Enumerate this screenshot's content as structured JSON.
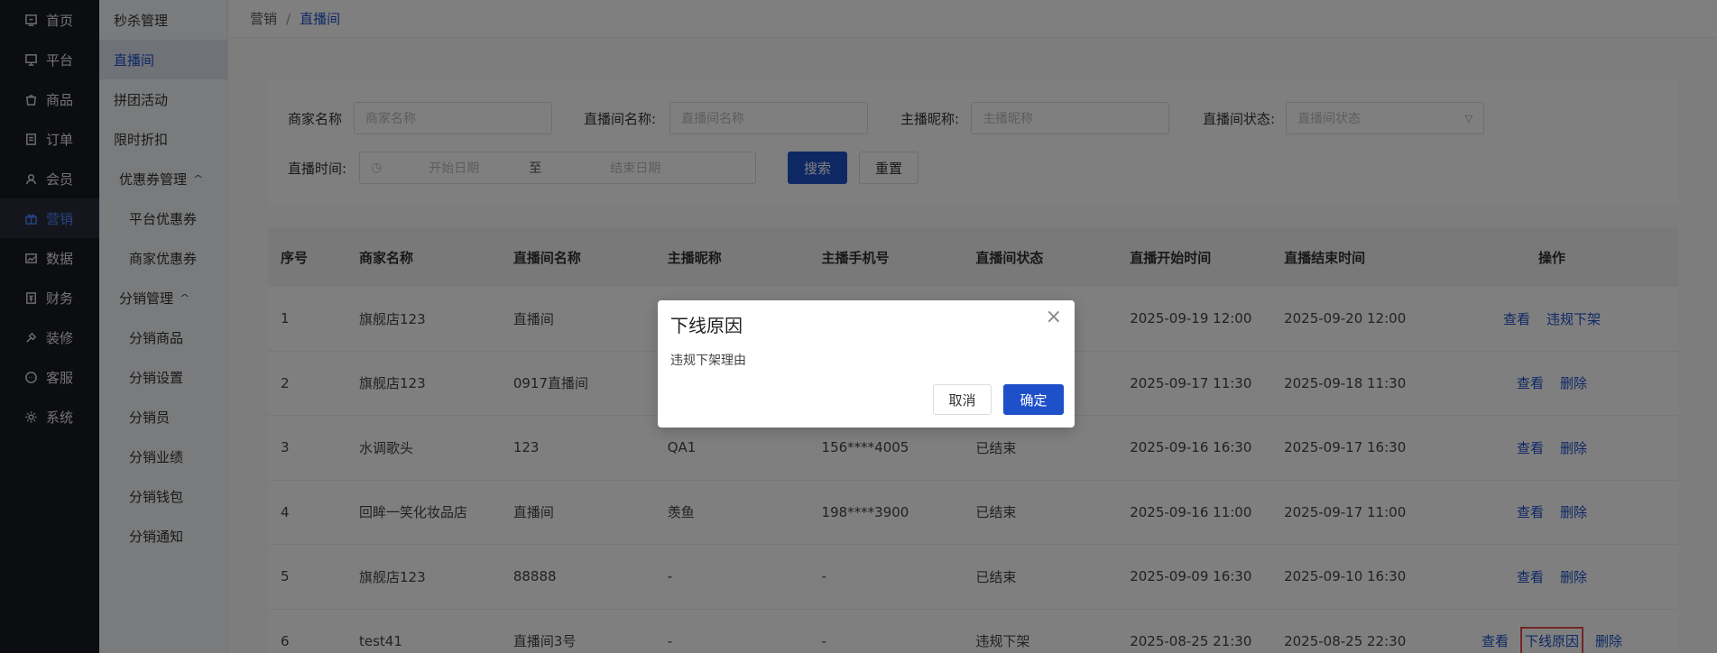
{
  "nav": {
    "items": [
      {
        "label": "首页",
        "icon": "home-icon"
      },
      {
        "label": "平台",
        "icon": "platform-icon"
      },
      {
        "label": "商品",
        "icon": "goods-icon"
      },
      {
        "label": "订单",
        "icon": "order-icon"
      },
      {
        "label": "会员",
        "icon": "member-icon"
      },
      {
        "label": "营销",
        "icon": "gift-icon"
      },
      {
        "label": "数据",
        "icon": "data-icon"
      },
      {
        "label": "财务",
        "icon": "finance-icon"
      },
      {
        "label": "装修",
        "icon": "decorate-icon"
      },
      {
        "label": "客服",
        "icon": "chat-icon"
      },
      {
        "label": "系统",
        "icon": "gear-icon"
      }
    ]
  },
  "subnav": {
    "items": [
      "秒杀管理",
      "直播间",
      "拼团活动",
      "限时折扣",
      "优惠券管理",
      "平台优惠券",
      "商家优惠券",
      "分销管理",
      "分销商品",
      "分销设置",
      "分销员",
      "分销业绩",
      "分销钱包",
      "分销通知"
    ]
  },
  "breadcrumb": {
    "parent": "营销",
    "separator": "/",
    "current": "直播间"
  },
  "filters": {
    "merchant_label": "商家名称",
    "merchant_placeholder": "商家名称",
    "room_label": "直播间名称:",
    "room_placeholder": "直播间名称",
    "anchor_label": "主播昵称:",
    "anchor_placeholder": "主播昵称",
    "status_label": "直播间状态:",
    "status_placeholder": "直播间状态",
    "time_label": "直播时间:",
    "start_placeholder": "开始日期",
    "range_sep": "至",
    "end_placeholder": "结束日期",
    "search_btn": "搜索",
    "reset_btn": "重置"
  },
  "table": {
    "headers": [
      "序号",
      "商家名称",
      "直播间名称",
      "主播昵称",
      "主播手机号",
      "直播间状态",
      "直播开始时间",
      "直播结束时间",
      "操作"
    ],
    "rows": [
      [
        "1",
        "旗舰店123",
        "直播间",
        "",
        "",
        "",
        "2025-09-19 12:00",
        "2025-09-20 12:00"
      ],
      [
        "2",
        "旗舰店123",
        "0917直播间",
        "",
        "",
        "",
        "2025-09-17 11:30",
        "2025-09-18 11:30"
      ],
      [
        "3",
        "水调歌头",
        "123",
        "QA1",
        "156****4005",
        "已结束",
        "2025-09-16 16:30",
        "2025-09-17 16:30"
      ],
      [
        "4",
        "回眸一笑化妆品店",
        "直播间",
        "羡鱼",
        "198****3900",
        "已结束",
        "2025-09-16 11:00",
        "2025-09-17 11:00"
      ],
      [
        "5",
        "旗舰店123",
        "88888",
        "-",
        "-",
        "已结束",
        "2025-09-09 16:30",
        "2025-09-10 16:30"
      ],
      [
        "6",
        "test41",
        "直播间3号",
        "-",
        "-",
        "违规下架",
        "2025-08-25 21:30",
        "2025-08-25 22:30"
      ]
    ],
    "ops": {
      "view": "查看",
      "takedown": "违规下架",
      "delete": "删除",
      "offline_reason": "下线原因"
    }
  },
  "dialog": {
    "title": "下线原因",
    "close": "×",
    "body": "违规下架理由",
    "cancel": "取消",
    "confirm": "确定"
  },
  "colors": {
    "primary": "#1d50c9",
    "nav_bg": "#191a23",
    "highlight": "#e54d4d"
  }
}
